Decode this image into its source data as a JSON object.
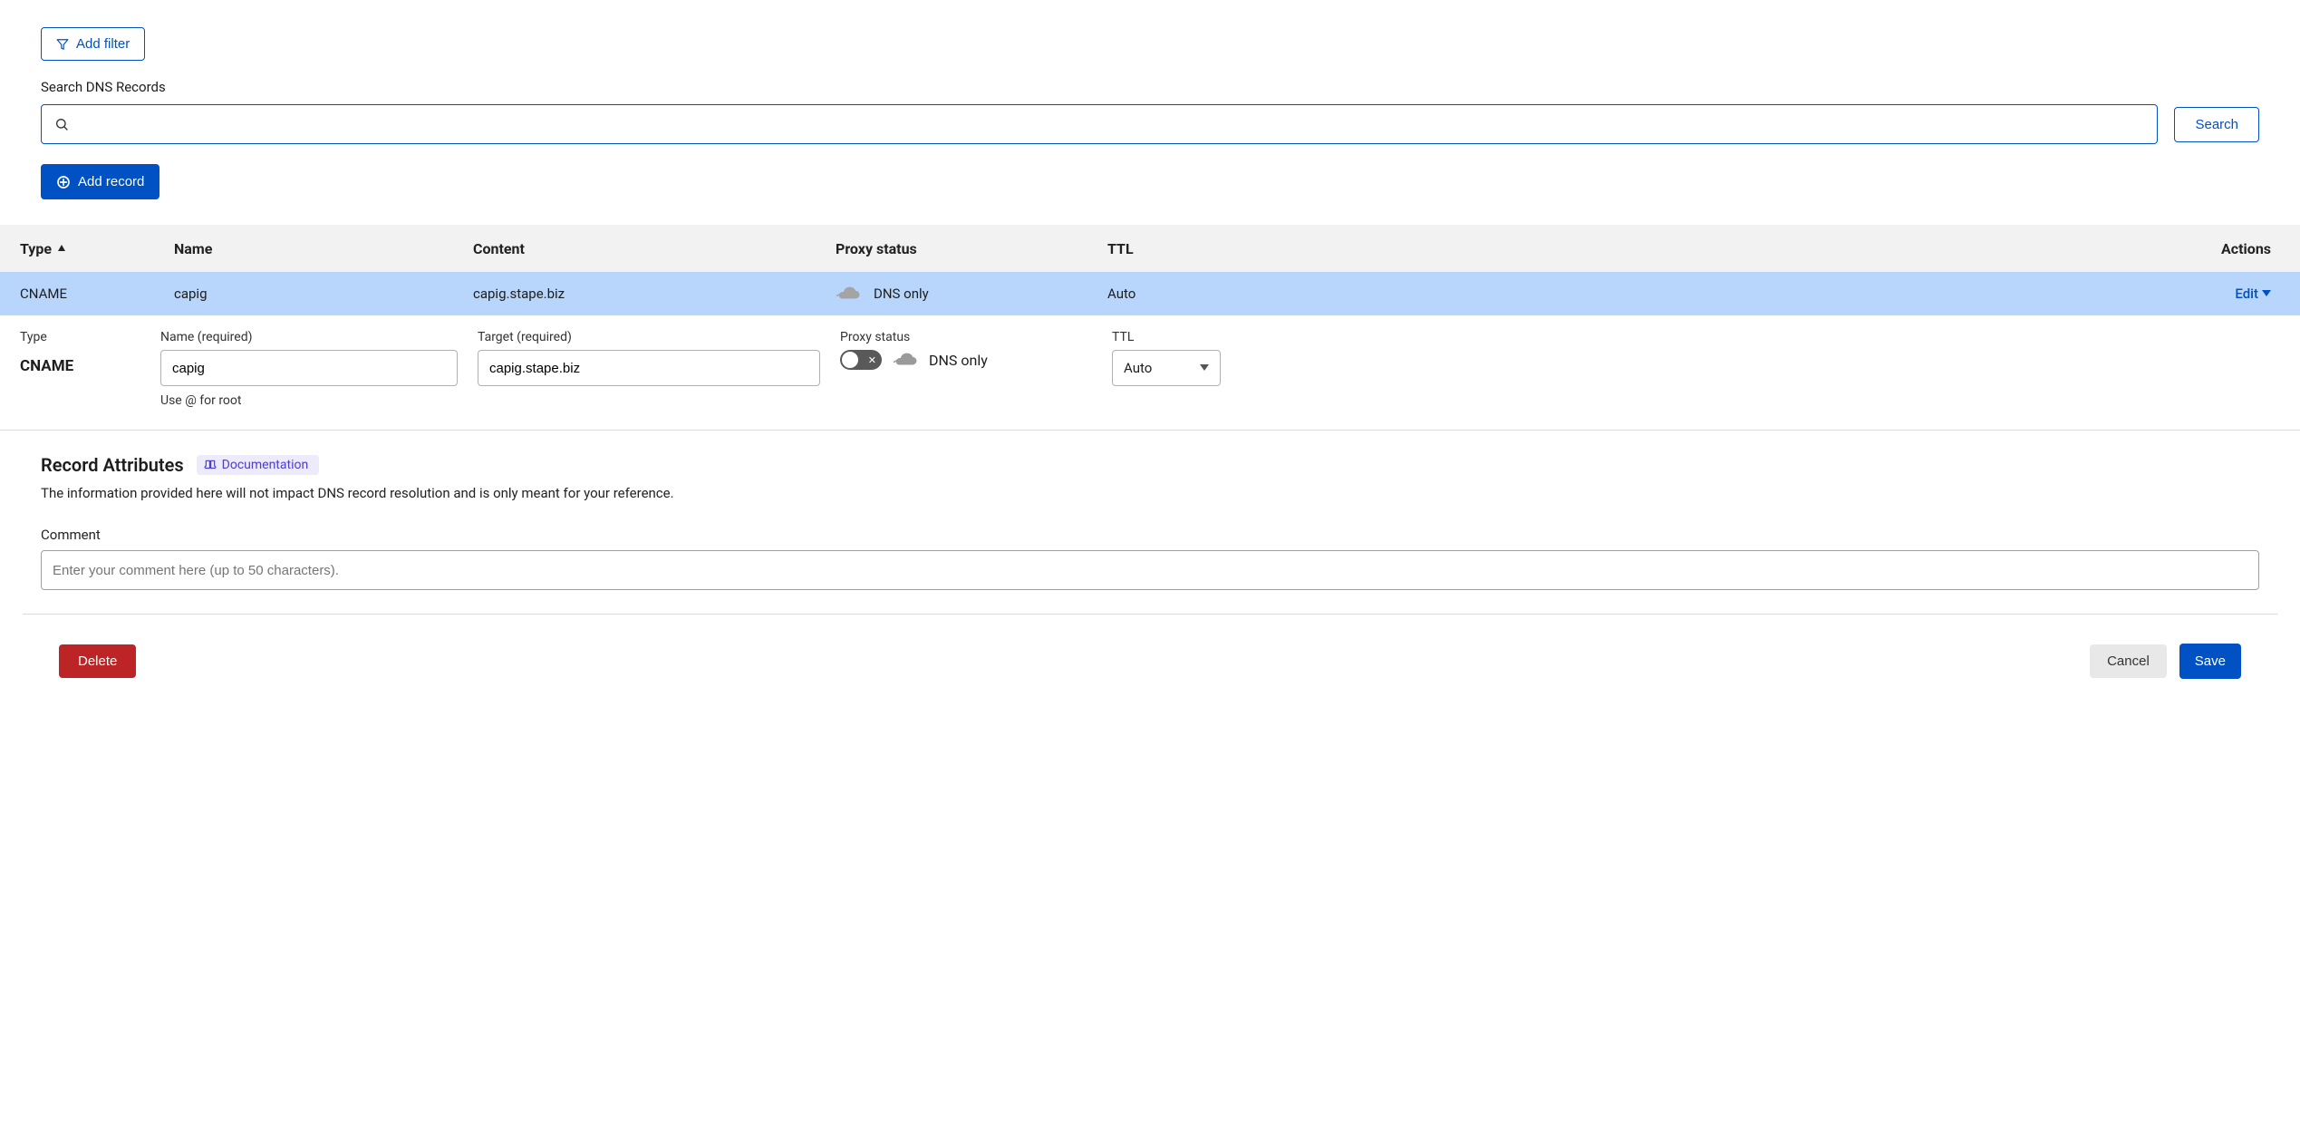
{
  "toolbar": {
    "add_filter_label": "Add filter",
    "search_label": "Search DNS Records",
    "search_value": "",
    "search_button_label": "Search",
    "add_record_label": "Add record"
  },
  "columns": {
    "type": "Type",
    "name": "Name",
    "content": "Content",
    "proxy": "Proxy status",
    "ttl": "TTL",
    "actions": "Actions"
  },
  "record": {
    "type": "CNAME",
    "name": "capig",
    "content": "capig.stape.biz",
    "proxy_status": "DNS only",
    "ttl": "Auto",
    "edit_label": "Edit"
  },
  "edit": {
    "type_label": "Type",
    "type_value": "CNAME",
    "name_label": "Name (required)",
    "name_value": "capig",
    "name_hint": "Use @ for root",
    "target_label": "Target (required)",
    "target_value": "capig.stape.biz",
    "proxy_label": "Proxy status",
    "proxy_value": "DNS only",
    "ttl_label": "TTL",
    "ttl_value": "Auto"
  },
  "attributes": {
    "title": "Record Attributes",
    "doc_label": "Documentation",
    "description": "The information provided here will not impact DNS record resolution and is only meant for your reference.",
    "comment_label": "Comment",
    "comment_placeholder": "Enter your comment here (up to 50 characters)."
  },
  "footer": {
    "delete_label": "Delete",
    "cancel_label": "Cancel",
    "save_label": "Save"
  }
}
